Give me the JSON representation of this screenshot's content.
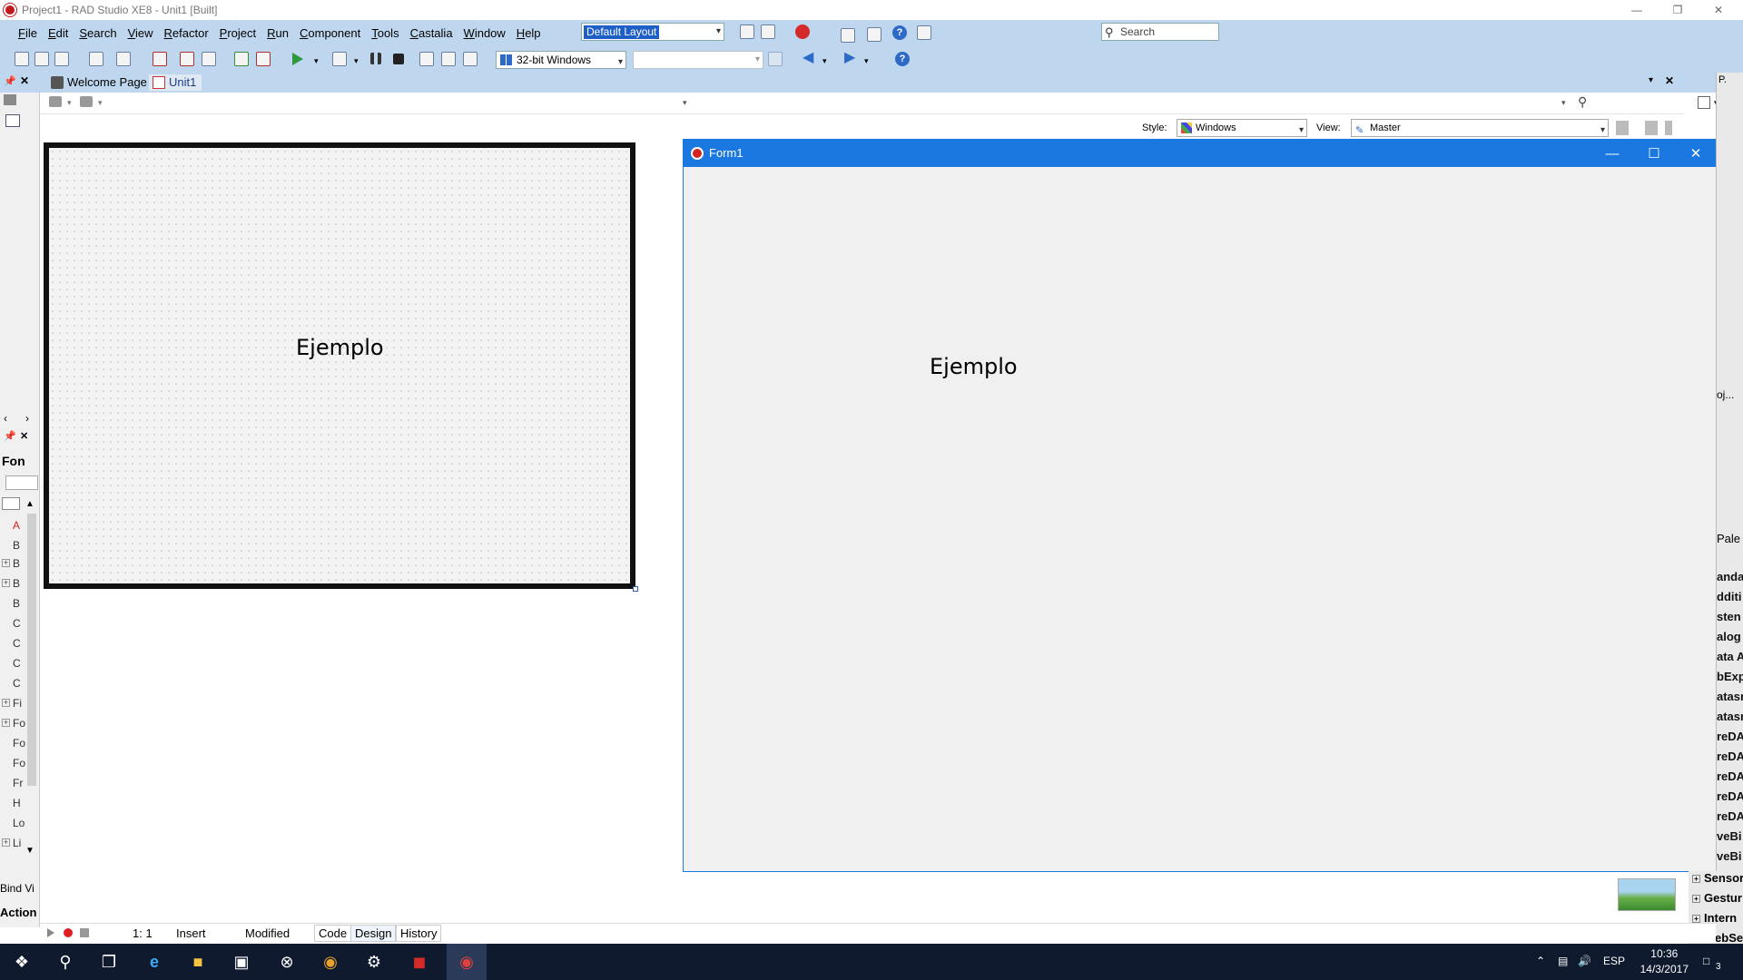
{
  "window": {
    "title": "Project1 - RAD Studio XE8 - Unit1 [Built]"
  },
  "menu": {
    "items": [
      "File",
      "Edit",
      "Search",
      "View",
      "Refactor",
      "Project",
      "Run",
      "Component",
      "Tools",
      "Castalia",
      "Window",
      "Help"
    ]
  },
  "toolbar": {
    "layout_value": "Default Layout",
    "search_placeholder": "Search",
    "platform_value": "32-bit Windows"
  },
  "tabs": {
    "welcome": "Welcome Page",
    "unit1": "Unit1"
  },
  "designer_toolbar": {
    "style_label": "Style:",
    "style_value": "Windows",
    "view_label": "View:",
    "view_value": "Master"
  },
  "designer_form": {
    "label_caption": "Ejemplo"
  },
  "running_form": {
    "title": "Form1",
    "label_caption": "Ejemplo"
  },
  "left_panel": {
    "header": "Fon",
    "letters": [
      "A",
      "B",
      "B",
      "B",
      "B",
      "C",
      "C",
      "C",
      "C",
      "Fi",
      "Fo",
      "Fo",
      "Fo",
      "Fr",
      "H",
      "Lo",
      "Li"
    ],
    "bind_visually": "Bind Vi",
    "action": "Action"
  },
  "right_panel": {
    "top_label": "P.",
    "proj_label": "oj...",
    "palette_label": "Pale",
    "items": [
      "anda",
      "dditi",
      "sten",
      "alog",
      "ata A",
      "bExp",
      "atasr",
      "atasr",
      "reDA",
      "reDA",
      "reDA",
      "reDA",
      "reDA",
      "veBi",
      "veBi"
    ],
    "lower_items": [
      "Sensor",
      "Gestur",
      "Intern",
      "WebSe"
    ]
  },
  "statusbar": {
    "position": "1:  1",
    "mode": "Insert",
    "state": "Modified",
    "tabs": [
      "Code",
      "Design",
      "History"
    ]
  },
  "taskbar": {
    "language": "ESP",
    "time": "10:36",
    "date": "14/3/2017",
    "notification_count": "3"
  }
}
